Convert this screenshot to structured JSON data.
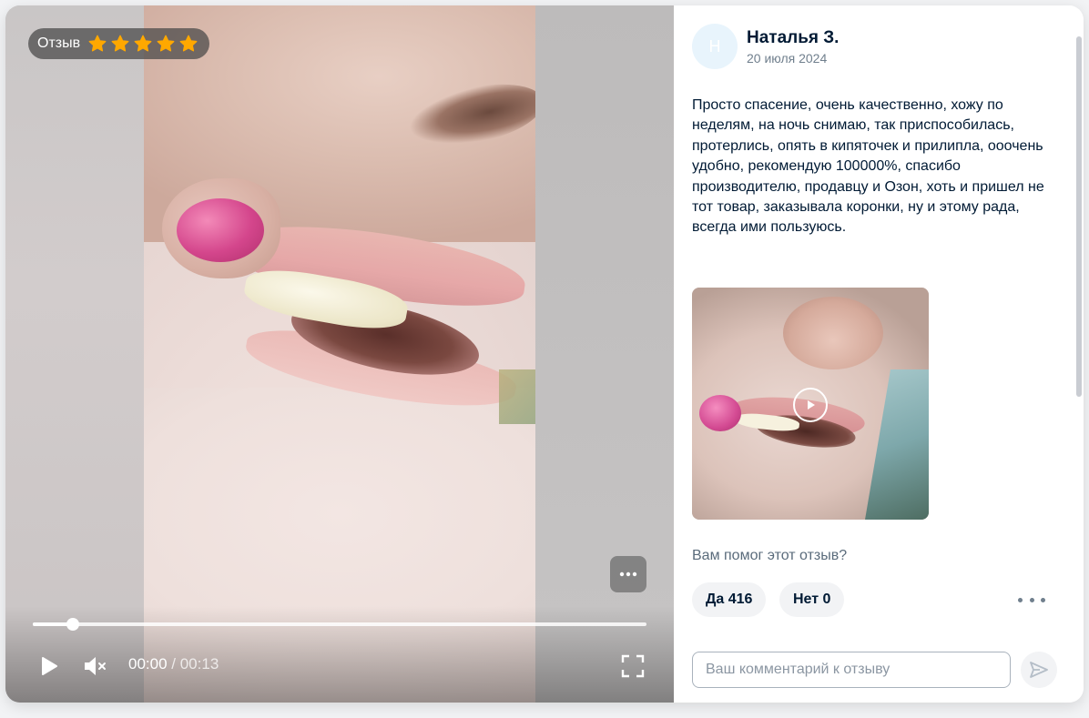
{
  "video": {
    "badge_label": "Отзыв",
    "rating": 5,
    "current_time": "00:00",
    "total_time": "/ 00:13",
    "progress": 0.065
  },
  "review": {
    "avatar_initial": "Н",
    "author": "Наталья З.",
    "date": "20 июля 2024",
    "text": "Просто спасение, очень качественно, хожу по неделям, на ночь снимаю, так приспособилась, протерлись, опять в кипяточек и прилипла, ооочень удобно, рекомендую 100000%, спасибо производителю, продавцу и Озон, хоть и пришел не тот товар, заказывала коронки, ну и этому рада, всегда ими пользуюсь."
  },
  "feedback": {
    "question": "Вам помог этот отзыв?",
    "yes_label": "Да 416",
    "no_label": "Нет 0"
  },
  "comment": {
    "placeholder": "Ваш комментарий к отзыву",
    "value": ""
  },
  "colors": {
    "star": "#ffa800",
    "text_primary": "#001a34",
    "text_secondary": "#707f8d",
    "button_bg": "#f2f3f5"
  },
  "icons": {
    "play": "play-icon",
    "mute": "muted-speaker-icon",
    "fullscreen": "fullscreen-icon",
    "more": "more-dots-icon",
    "send": "send-icon",
    "star": "star-icon"
  }
}
